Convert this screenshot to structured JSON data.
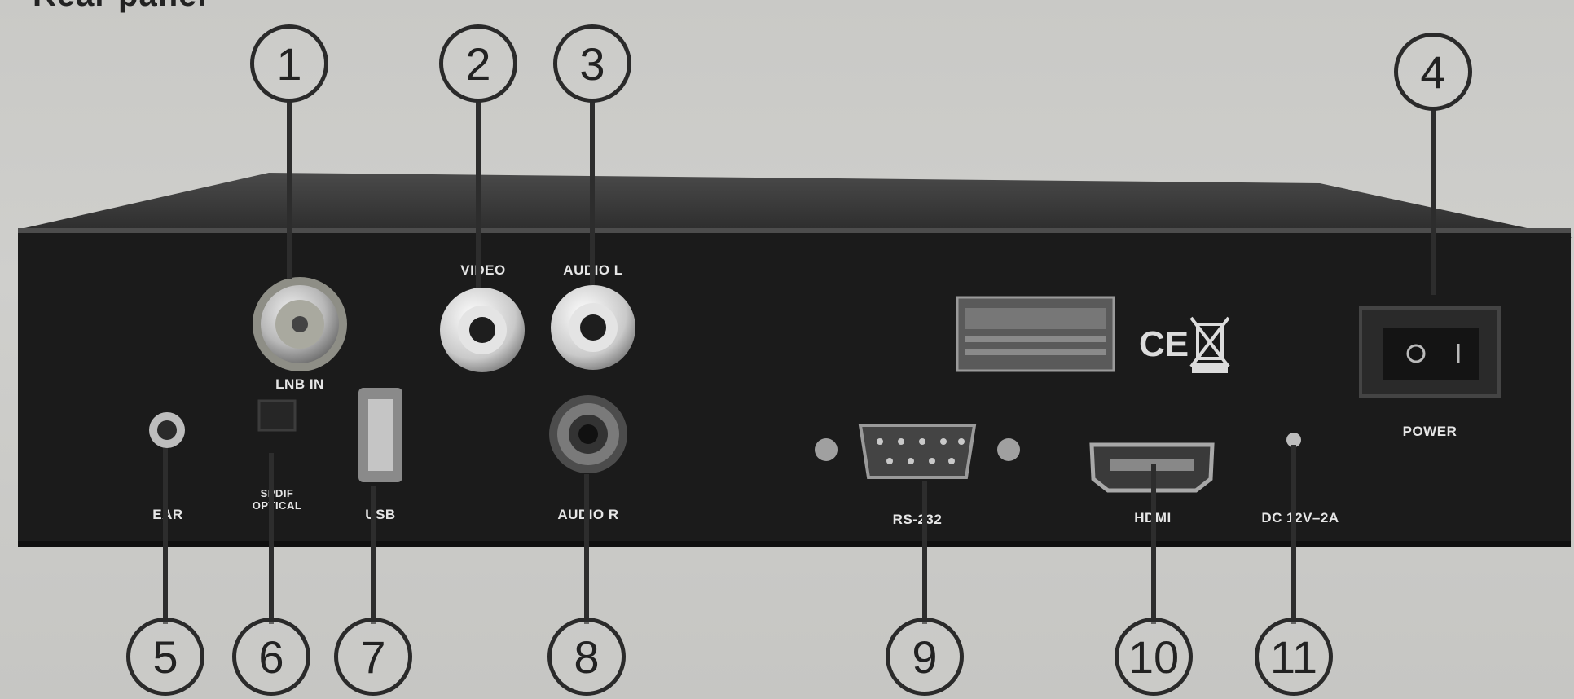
{
  "heading": "Rear panel",
  "callouts": [
    "1",
    "2",
    "3",
    "4",
    "5",
    "6",
    "7",
    "8",
    "9",
    "10",
    "11"
  ],
  "panel_labels": {
    "lnb_in": "LNB IN",
    "video": "VIDEO",
    "audio_l": "AUDIO L",
    "audio_r": "AUDIO R",
    "power": "POWER",
    "ear": "EAR",
    "spdif_line1": "SPDIF",
    "spdif_line2": "OPTICAL",
    "usb": "USB",
    "rs232": "RS-232",
    "hdmi": "HDMI",
    "dc": "DC 12V–2A"
  },
  "colors": {
    "background": "#cbcbc8",
    "box_front": "#1c1c1c",
    "box_top": "#3a3a3a",
    "callout_stroke": "#2a2a2a"
  }
}
